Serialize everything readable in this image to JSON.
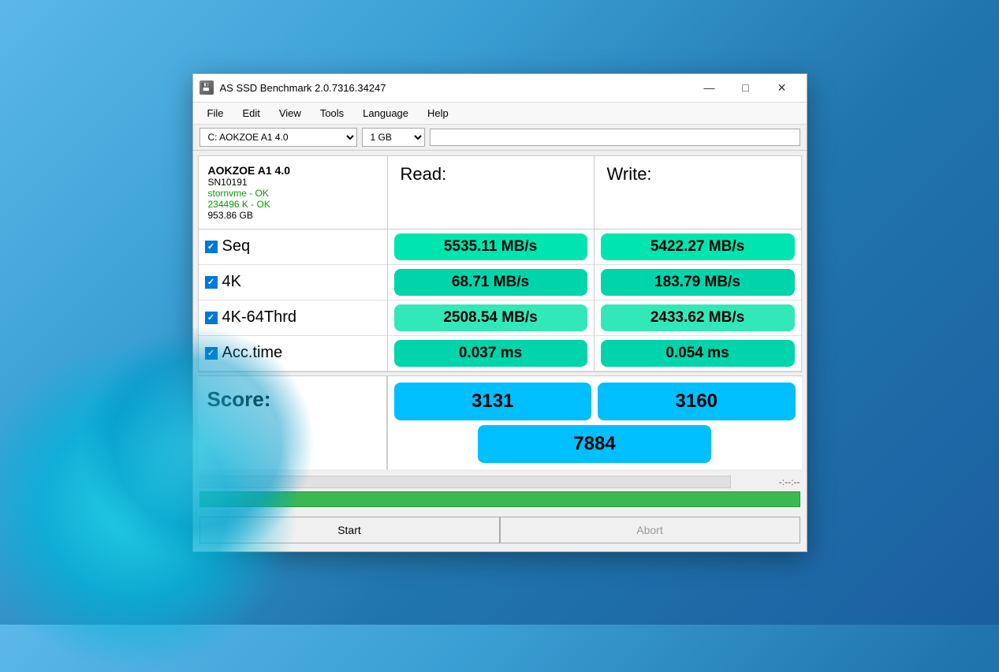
{
  "window": {
    "title": "AS SSD Benchmark 2.0.7316.34247",
    "icon": "💾"
  },
  "menu": {
    "items": [
      "File",
      "Edit",
      "View",
      "Tools",
      "Language",
      "Help"
    ]
  },
  "toolbar": {
    "drive_select": "C: AOKZOE A1 4.0",
    "size_select": "1 GB",
    "input_placeholder": ""
  },
  "drive_info": {
    "name": "AOKZOE A1 4.0",
    "serial": "SN10191",
    "status1": "stornvme - OK",
    "status2": "234496 K - OK",
    "size": "953.86 GB"
  },
  "headers": {
    "read": "Read:",
    "write": "Write:"
  },
  "rows": [
    {
      "label": "Seq",
      "read": "5535.11 MB/s",
      "write": "5422.27 MB/s"
    },
    {
      "label": "4K",
      "read": "68.71 MB/s",
      "write": "183.79 MB/s"
    },
    {
      "label": "4K-64Thrd",
      "read": "2508.54 MB/s",
      "write": "2433.62 MB/s"
    },
    {
      "label": "Acc.time",
      "read": "0.037 ms",
      "write": "0.054 ms"
    }
  ],
  "score": {
    "label": "Score:",
    "read": "3131",
    "write": "3160",
    "total": "7884"
  },
  "progress": {
    "timer": "-:--:--"
  },
  "buttons": {
    "start": "Start",
    "abort": "Abort"
  }
}
